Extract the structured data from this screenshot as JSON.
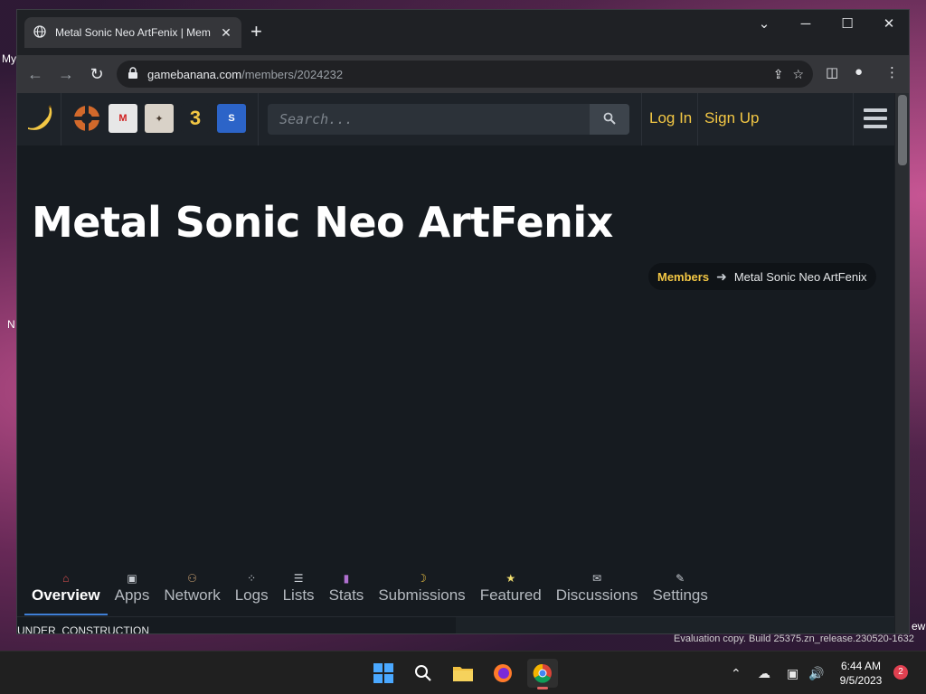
{
  "desktop": {
    "left_texts": [
      "My",
      "N"
    ],
    "right_text": "ew",
    "watermark": "Evaluation copy. Build 25375.zn_release.230520-1632"
  },
  "browser": {
    "tab_title": "Metal Sonic Neo ArtFenix | Members",
    "url_host": "gamebanana.com",
    "url_path": "/members/2024232"
  },
  "site": {
    "search_placeholder": "Search...",
    "login_label": "Log In",
    "signup_label": "Sign Up",
    "game_icons": [
      "team-fortress-2-icon",
      "mario-kart-icon",
      "genshin-icon",
      "sonic-3-air-icon",
      "sonic-mania-icon"
    ]
  },
  "page": {
    "title": "Metal Sonic Neo ArtFenix",
    "breadcrumb": {
      "parent": "Members",
      "current": "Metal Sonic Neo ArtFenix"
    },
    "tabs": [
      {
        "label": "Overview",
        "icon": "home-icon"
      },
      {
        "label": "Apps",
        "icon": "apps-icon"
      },
      {
        "label": "Network",
        "icon": "network-icon"
      },
      {
        "label": "Logs",
        "icon": "logs-icon"
      },
      {
        "label": "Lists",
        "icon": "lists-icon"
      },
      {
        "label": "Stats",
        "icon": "stats-icon"
      },
      {
        "label": "Submissions",
        "icon": "banana-icon"
      },
      {
        "label": "Featured",
        "icon": "star-icon"
      },
      {
        "label": "Discussions",
        "icon": "chat-icon"
      },
      {
        "label": "Settings",
        "icon": "wrench-icon"
      }
    ],
    "active_tab": "Overview",
    "under_construction": "UNDER_CONSTRUCTION"
  },
  "taskbar": {
    "time": "6:44 AM",
    "date": "9/5/2023",
    "notification_count": "2"
  },
  "colors": {
    "accent_yellow": "#f3c744",
    "page_bg": "#161b20",
    "header_bg": "#1e2329",
    "active_tab_underline": "#3f7fd6"
  }
}
